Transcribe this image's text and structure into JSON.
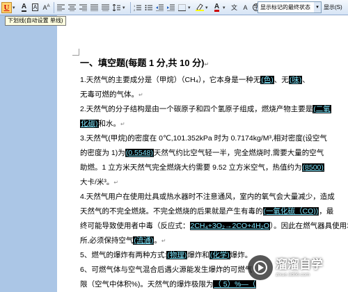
{
  "toolbar": {
    "tooltip": "下划线(自动设置 单线)",
    "review_display": "显示标记的最终状态",
    "show_button": "显示(S)"
  },
  "document": {
    "heading": "一、填空题(每题 1 分,共 10 分)",
    "lines": [
      [
        {
          "t": "1.天然气的主要成分是（甲烷）（CH₄），它本身是一种无"
        },
        {
          "t": "(色)",
          "h": true
        },
        {
          "t": "、无"
        },
        {
          "t": "(味)",
          "h": true
        },
        {
          "t": "、"
        }
      ],
      [
        {
          "t": "无毒可燃的气体。"
        }
      ],
      [
        {
          "t": "2.天然气的分子结构是由一个碳原子和四个氢原子组成，燃烧产物主要是"
        },
        {
          "t": "(二氧",
          "h": true
        }
      ],
      [
        {
          "t": "化碳)",
          "h": true
        },
        {
          "t": "和水。"
        }
      ],
      [
        {
          "t": "3.天然气(甲烷)的密度在 0℃,101.352kPa 时为 0.7174kg/M³,相对密度(设空气"
        }
      ],
      [
        {
          "t": "的密度为 1)为"
        },
        {
          "t": "(0.5548)",
          "h": true
        },
        {
          "t": "天然气约比空气轻一半，完全燃烧时,需要大量的空气"
        }
      ],
      [
        {
          "t": "助燃。1 立方米天然气完全燃烧大约需要 9.52 立方米空气，热值约为"
        },
        {
          "t": "(8500)",
          "h": true
        }
      ],
      [
        {
          "t": "大卡/米³。"
        }
      ],
      [
        {
          "t": "4.天然气用户在使用灶具或热水器时不注意通风，室内的氧气会大量减少，造成"
        }
      ],
      [
        {
          "t": "天然气的不完全燃烧。不完全燃烧的后果就是产生有毒的"
        },
        {
          "t": "(一氧化碳（CO))",
          "h": true
        },
        {
          "t": "，最"
        }
      ],
      [
        {
          "t": "终可能导致使用者中毒（反应式："
        },
        {
          "t": "2CH₄+3O₂→2CO+4H₂O",
          "h": true
        },
        {
          "t": "）。因此在燃气器具使用场"
        }
      ],
      [
        {
          "t": "所,必须保持空气"
        },
        {
          "t": "(流通)",
          "h": true
        },
        {
          "t": "。"
        }
      ],
      [
        {
          "t": "5、燃气的爆炸有两种方式:"
        },
        {
          "t": "(物理)",
          "h": true
        },
        {
          "t": "爆炸和"
        },
        {
          "t": "(化学)",
          "h": true
        },
        {
          "t": "爆炸。"
        }
      ],
      [
        {
          "t": "6、可燃气体与空气混合后遇火源能发生爆炸的可燃气"
        }
      ],
      [
        {
          "t": "限（空气中体积%)。天然气的爆炸极限为"
        },
        {
          "t": "（ 5）%—（",
          "h": true
        }
      ]
    ]
  },
  "watermark": {
    "text": "溜溜自学",
    "url": "zixue.3d66.com"
  }
}
